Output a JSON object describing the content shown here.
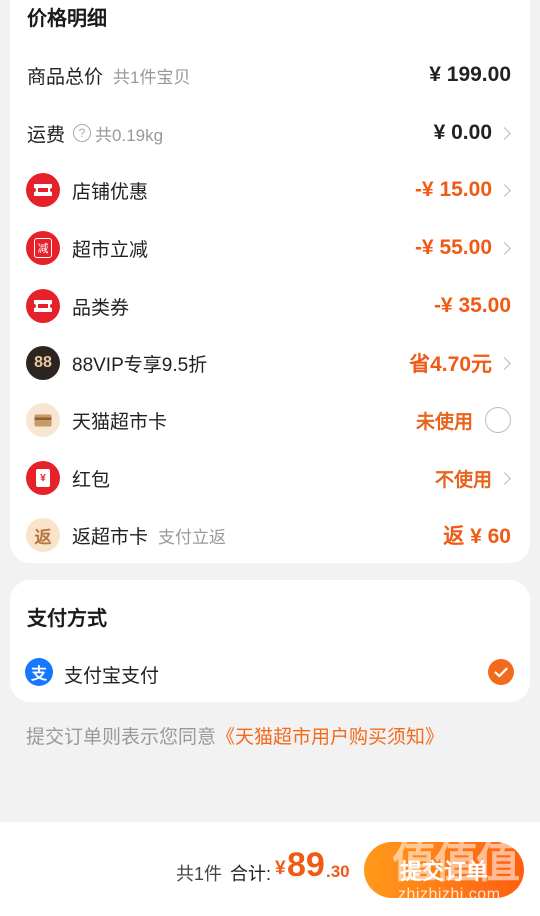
{
  "price_detail": {
    "title": "价格明细",
    "rows": [
      {
        "label": "商品总价",
        "sub": "共1件宝贝",
        "value": "¥ 199.00"
      },
      {
        "label": "运费",
        "sub": "共0.19kg",
        "value": "¥ 0.00"
      },
      {
        "label": "店铺优惠",
        "value": "-¥ 15.00"
      },
      {
        "label": "超市立减",
        "value": "-¥ 55.00"
      },
      {
        "label": "品类券",
        "value": "-¥ 35.00"
      },
      {
        "label": "88VIP专享9.5折",
        "value": "省4.70元"
      },
      {
        "label": "天猫超市卡",
        "value": "未使用"
      },
      {
        "label": "红包",
        "value": "不使用"
      },
      {
        "label": "返超市卡",
        "sub": "支付立返",
        "value": "返 ¥ 60"
      }
    ],
    "icon_text": {
      "jian": "减",
      "vip": "88",
      "fan": "返",
      "hongbao": "¥"
    }
  },
  "payment": {
    "title": "支付方式",
    "method": "支付宝支付",
    "icon_text": "支"
  },
  "agreement": {
    "prefix": "提交订单则表示您同意",
    "link": "《天猫超市用户购买须知》"
  },
  "footer": {
    "count": "共1件",
    "total_label": "合计:",
    "currency": "¥",
    "total_int": "89",
    "total_dec": ".30",
    "submit": "提交订单"
  },
  "watermark": {
    "big": "值值值",
    "small": "zhizhizhi.com"
  },
  "colors": {
    "accent": "#f05a14",
    "red_icon": "#e6212a",
    "alipay": "#1677ff"
  }
}
